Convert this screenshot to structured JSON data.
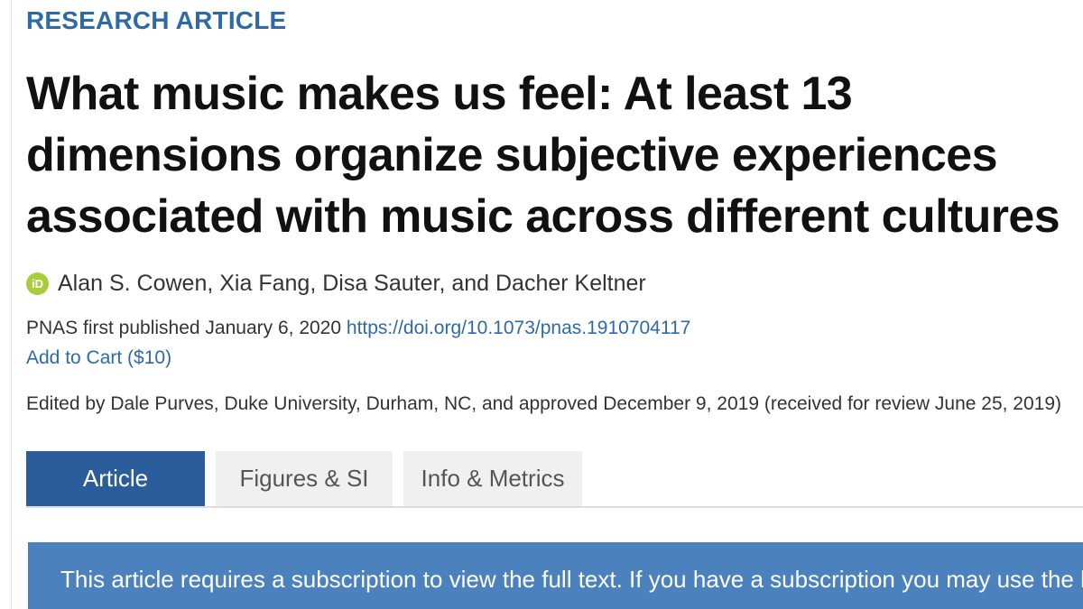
{
  "article": {
    "section_label": "RESEARCH ARTICLE",
    "title": "What music makes us feel: At least 13 dimensions organize subjective experiences associated with music across different cultures",
    "orcid_icon_label": "iD",
    "authors": "Alan S. Cowen, Xia Fang, Disa Sauter, and Dacher Keltner",
    "published_prefix": "PNAS first published January 6, 2020",
    "doi": "https://doi.org/10.1073/pnas.1910704117",
    "add_to_cart": "Add to Cart ($10)",
    "edited_by": "Edited by Dale Purves, Duke University, Durham, NC, and approved December 9, 2019 (received for review June 25, 2019)"
  },
  "tabs": [
    {
      "label": "Article",
      "active": true
    },
    {
      "label": "Figures & SI",
      "active": false
    },
    {
      "label": "Info & Metrics",
      "active": false
    }
  ],
  "notice": {
    "text": "This article requires a subscription to view the full text. If you have a subscription you may use the login form below to view the article."
  },
  "colors": {
    "accent": "#2e6aa8",
    "active_tab": "#2b5d9d",
    "notice_bg": "#4b82be",
    "orcid": "#a6ce39"
  },
  "icons": {
    "orcid": "orcid-icon"
  }
}
